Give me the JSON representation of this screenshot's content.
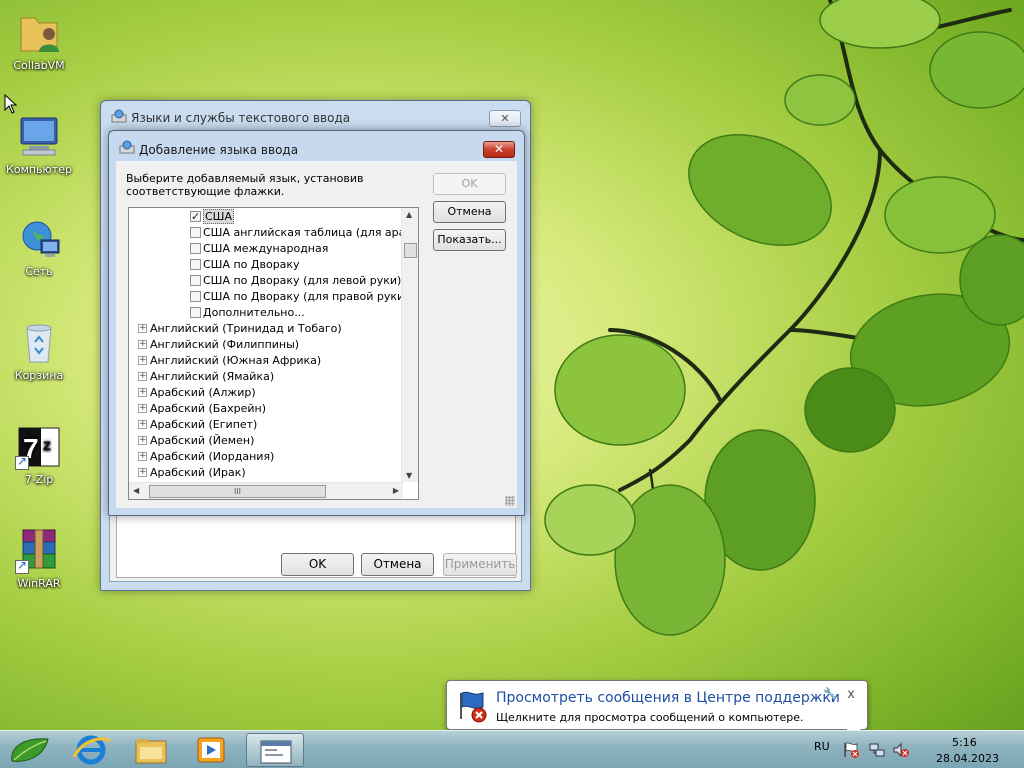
{
  "desktop": {
    "icons": [
      {
        "label": "CollabVM",
        "icon": "folder-user-icon"
      },
      {
        "label": "Компьютер",
        "icon": "computer-icon"
      },
      {
        "label": "Сеть",
        "icon": "network-globe-icon"
      },
      {
        "label": "Корзина",
        "icon": "recycle-bin-icon"
      },
      {
        "label": "7-Zip",
        "icon": "7zip-icon"
      },
      {
        "label": "WinRAR",
        "icon": "winrar-icon"
      }
    ]
  },
  "outer_dialog": {
    "title": "Языки и службы текстового ввода",
    "close_symbol": "✕",
    "ok_label": "OK",
    "cancel_label": "Отмена",
    "apply_label": "Применить"
  },
  "inner_dialog": {
    "title": "Добавление языка ввода",
    "close_symbol": "✕",
    "instruction": "Выберите добавляемый язык, установив соответствующие флажки.",
    "ok_label": "OK",
    "cancel_label": "Отмена",
    "show_label": "Показать...",
    "tree_items": [
      {
        "label": "США",
        "type": "checkbox",
        "checked": true,
        "selected": true,
        "level": 3
      },
      {
        "label": "США английская таблица (для арабск",
        "type": "checkbox",
        "checked": false,
        "level": 3
      },
      {
        "label": "США международная",
        "type": "checkbox",
        "checked": false,
        "level": 3
      },
      {
        "label": "США по Двораку",
        "type": "checkbox",
        "checked": false,
        "level": 3
      },
      {
        "label": "США по Двораку (для левой руки)",
        "type": "checkbox",
        "checked": false,
        "level": 3
      },
      {
        "label": "США по Двораку (для правой руки)",
        "type": "checkbox",
        "checked": false,
        "level": 3
      },
      {
        "label": "Дополнительно...",
        "type": "checkbox",
        "checked": false,
        "level": 3
      },
      {
        "label": "Английский (Тринидад и Тобаго)",
        "type": "expander",
        "level": 1
      },
      {
        "label": "Английский (Филиппины)",
        "type": "expander",
        "level": 1
      },
      {
        "label": "Английский (Южная Африка)",
        "type": "expander",
        "level": 1
      },
      {
        "label": "Английский (Ямайка)",
        "type": "expander",
        "level": 1
      },
      {
        "label": "Арабский (Алжир)",
        "type": "expander",
        "level": 1
      },
      {
        "label": "Арабский (Бахрейн)",
        "type": "expander",
        "level": 1
      },
      {
        "label": "Арабский (Египет)",
        "type": "expander",
        "level": 1
      },
      {
        "label": "Арабский (Йемен)",
        "type": "expander",
        "level": 1
      },
      {
        "label": "Арабский (Иордания)",
        "type": "expander",
        "level": 1
      },
      {
        "label": "Арабский (Ирак)",
        "type": "expander",
        "level": 1
      }
    ],
    "hscroll_thumb_glyph": "III"
  },
  "notification": {
    "title": "Просмотреть сообщения в Центре поддержки",
    "text": "Щелкните для просмотра сообщений о компьютере.",
    "close_symbol": "x",
    "wrench_symbol": "🔧"
  },
  "taskbar": {
    "apps": [
      "start-orb-icon",
      "internet-explorer-icon",
      "file-explorer-icon",
      "media-player-icon",
      "control-panel-window-icon"
    ],
    "language": "RU",
    "time": "5:16",
    "date": "28.04.2023"
  }
}
